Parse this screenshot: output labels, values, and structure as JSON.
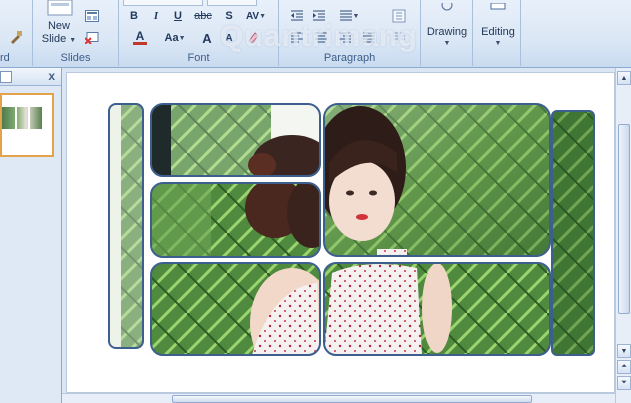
{
  "ribbon": {
    "clipboard": {
      "label_fragment": "rd"
    },
    "slides": {
      "label": "Slides",
      "new_slide_line1": "New",
      "new_slide_line2": "Slide"
    },
    "font": {
      "label": "Font",
      "bold": "B",
      "italic": "I",
      "underline": "U",
      "strike": "abc",
      "shadow": "S",
      "spacing": "AV",
      "color": "A",
      "change_case": "Aa",
      "grow": "A",
      "shrink": "A"
    },
    "paragraph": {
      "label": "Paragraph"
    },
    "drawing": {
      "label": "Drawing"
    },
    "editing": {
      "label": "Editing"
    }
  },
  "pane": {
    "close": "x"
  },
  "watermark": {
    "text": "Quantrimang"
  },
  "colors": {
    "accent_border": "#3d5f8e",
    "thumb_selected": "#e3a34a"
  }
}
